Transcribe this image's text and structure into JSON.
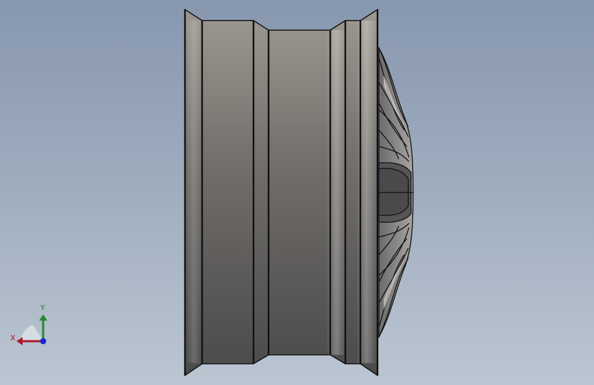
{
  "viewport": {
    "background_top": "#8797ae",
    "background_bottom": "#bcc6d2"
  },
  "model": {
    "part": "wheel-rim",
    "view": "side"
  },
  "triad": {
    "x_label": "X",
    "y_label": "Y",
    "x_color": "#b0182a",
    "y_color": "#1e8a2a",
    "z_color": "#1a2ad0"
  }
}
